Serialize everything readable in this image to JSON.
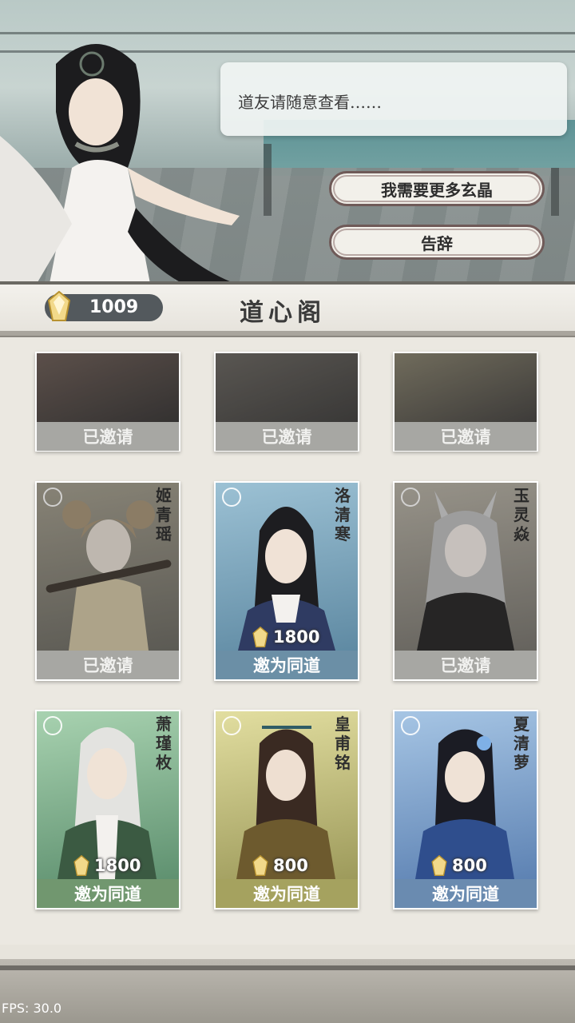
{
  "dialog": {
    "text": "道友请随意查看……"
  },
  "options": {
    "more_crystals": "我需要更多玄晶",
    "leave": "告辞"
  },
  "header": {
    "crystal_count": "1009",
    "title": "道心阁"
  },
  "cards_top": [
    {
      "status": "已邀请"
    },
    {
      "status": "已邀请"
    },
    {
      "status": "已邀请"
    }
  ],
  "cards": [
    {
      "name": "姬青瑶",
      "status": "已邀请",
      "invited": true
    },
    {
      "name": "洛清寒",
      "price": "1800",
      "action": "邀为同道",
      "invited": false
    },
    {
      "name": "玉灵焱",
      "status": "已邀请",
      "invited": true
    },
    {
      "name": "萧瑾枚",
      "price": "1800",
      "action": "邀为同道",
      "invited": false
    },
    {
      "name": "皇甫铭",
      "price": "800",
      "action": "邀为同道",
      "invited": false
    },
    {
      "name": "夏清萝",
      "price": "800",
      "action": "邀为同道",
      "invited": false
    }
  ],
  "fps": "FPS: 30.0",
  "colors": {
    "invite_blue": "#6b8fa6",
    "invite_green": "#71976f",
    "invite_yellow": "#a5a25f",
    "invited_gray": "#a7a7a3"
  }
}
